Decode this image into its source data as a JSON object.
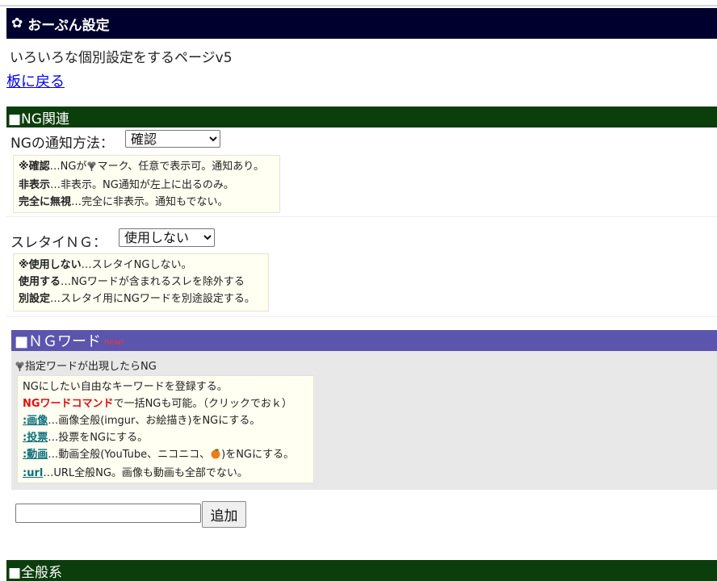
{
  "header": {
    "title": "おーぷん設定",
    "subtitle": "いろいろな個別設定をするページv5",
    "back_link": "板に戻る"
  },
  "ng_section": {
    "title": "■NG関連",
    "notify": {
      "label": "NGの通知方法：",
      "selected": "確認",
      "note": {
        "l1_bold": "※確認",
        "l1_a": "…NGが",
        "l1_b": "マーク、任意で表示可。通知あり。",
        "l2_bold": "非表示",
        "l2_rest": "…非表示。NG通知が左上に出るのみ。",
        "l3_bold": "完全に無視",
        "l3_rest": "…完全に非表示。通知もでない。"
      }
    },
    "thread_title_ng": {
      "label": "スレタイＮＧ：",
      "selected": "使用しない",
      "note": {
        "l1_bold": "※使用しない",
        "l1_rest": "…スレタイNGしない。",
        "l2_bold": "使用する",
        "l2_rest": "…NGワードが含まれるスレを除外する",
        "l3_bold": "別設定",
        "l3_rest": "…スレタイ用にNGワードを別途設定する。"
      }
    }
  },
  "ng_word": {
    "title": "■ＮＧワード",
    "badge": "new!",
    "desc": "指定ワードが出現したらNG",
    "note": {
      "l1": "NGにしたい自由なキーワードを登録する。",
      "l2_red": "NGワードコマンド",
      "l2_rest": "で一括NGも可能。（クリックでおｋ）",
      "l3_cmd": ":画像",
      "l3_rest": "…画像全般(imgur、お絵描き)をNGにする。",
      "l4_cmd": ":投票",
      "l4_rest": "…投票をNGにする。",
      "l5_cmd": ":動画",
      "l5_a": "…動画全般(YouTube、ニコニコ、",
      "l5_b": ")をNGにする。",
      "l6_cmd": ":url",
      "l6_rest": "…URL全般NG。画像も動画も全部でない。"
    },
    "input_value": "",
    "add_button": "追加"
  },
  "general_section": {
    "title": "■全般系"
  },
  "colors": {
    "title_bg": "#00002e",
    "section_bg": "#0c3d0c",
    "ngword_bg": "#5b55ae",
    "command_red": "#e01010",
    "command_teal": "#0b6f7a"
  },
  "icons": {
    "title": "gear-icon",
    "ng_mark": "ng-flower-icon",
    "video_site": "orange-fruit-icon"
  }
}
